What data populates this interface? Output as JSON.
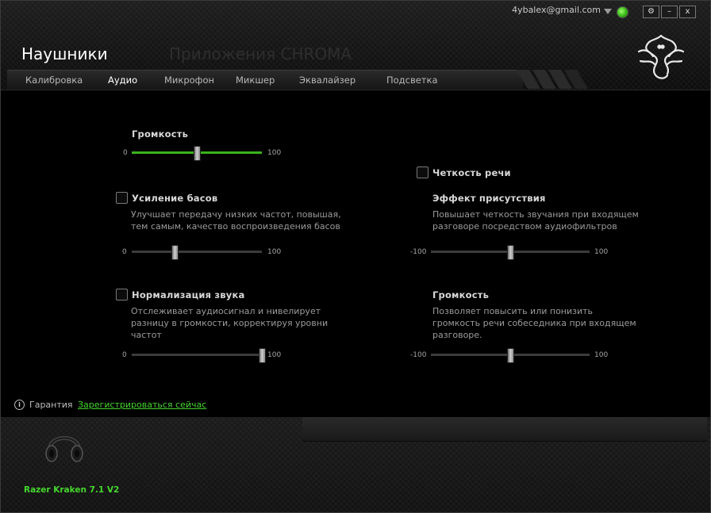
{
  "header": {
    "account_email": "4ybalex@gmail.com",
    "title": "Наушники",
    "chroma_title": "Приложения CHROMA",
    "window_buttons": [
      "⚙",
      "–",
      "x"
    ]
  },
  "tabs": [
    {
      "label": "Калибровка",
      "active": false
    },
    {
      "label": "Аудио",
      "active": true
    },
    {
      "label": "Микрофон",
      "active": false
    },
    {
      "label": "Микшер",
      "active": false
    },
    {
      "label": "Эквалайзер",
      "active": false
    },
    {
      "label": "Подсветка",
      "active": false
    }
  ],
  "volume": {
    "label": "Громкость",
    "min": "0",
    "max": "100",
    "value": 50
  },
  "bass_boost": {
    "label": "Усиление басов",
    "checked": false,
    "desc": [
      "Улучшает передачу низких частот, повышая,",
      "тем самым, качество воспроизведения басов"
    ],
    "min": "0",
    "max": "100",
    "value": 33
  },
  "sound_normalization": {
    "label": "Нормализация звука",
    "checked": false,
    "desc": [
      "Отслеживает аудиосигнал и нивелирует",
      "разницу в громкости, корректируя уровни",
      "частот"
    ],
    "min": "0",
    "max": "100",
    "value": 100
  },
  "voice_clarity": {
    "label": "Четкость речи",
    "checked": false
  },
  "presence_effect": {
    "label": "Эффект присутствия",
    "desc": [
      "Повышает четкость звучания при входящем",
      "разговоре посредством аудиофильтров"
    ],
    "min": "-100",
    "max": "100",
    "value": 0
  },
  "voice_volume": {
    "label": "Громкость",
    "desc": [
      "Позволяет повысить или понизить",
      "громкость речи собеседника при входящем",
      "разговоре."
    ],
    "min": "-100",
    "max": "100",
    "value": 0
  },
  "warranty": {
    "label": "Гарантия",
    "link": "Зарегистрироваться сейчас"
  },
  "device": {
    "name": "Razer Kraken 7.1 V2"
  },
  "colors": {
    "accent_green": "#44d62c",
    "slider_fill": "#3ab21c"
  }
}
